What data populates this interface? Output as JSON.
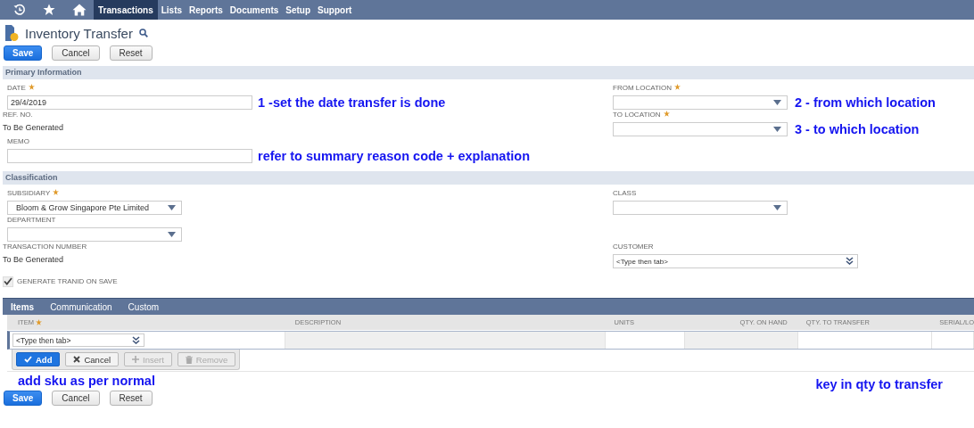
{
  "nav": {
    "menu": [
      {
        "label": "Transactions",
        "selected": true
      },
      {
        "label": "Lists",
        "selected": false
      },
      {
        "label": "Reports",
        "selected": false
      },
      {
        "label": "Documents",
        "selected": false
      },
      {
        "label": "Setup",
        "selected": false
      },
      {
        "label": "Support",
        "selected": false
      }
    ]
  },
  "page": {
    "title": "Inventory Transfer"
  },
  "top_buttons": [
    {
      "label": "Save",
      "kind": "primary"
    },
    {
      "label": "Cancel",
      "kind": "secondary"
    },
    {
      "label": "Reset",
      "kind": "secondary"
    }
  ],
  "sections": [
    {
      "title": "Primary Information",
      "rows": [
        {
          "left": {
            "kind": "text",
            "label": "DATE",
            "required": true,
            "value": "29/4/2019",
            "annotation": "1 -set the date transfer is done"
          },
          "right": {
            "kind": "select",
            "label": "FROM LOCATION",
            "required": true,
            "annotation": "2 - from which location"
          }
        },
        {
          "left": {
            "kind": "static",
            "label": "REF. NO.",
            "value": "To Be Generated"
          },
          "right": {
            "kind": "select",
            "label": "TO LOCATION",
            "required": true,
            "annotation": "3 - to which location"
          }
        },
        {
          "left": {
            "kind": "text",
            "label": "MEMO",
            "annotation": "refer to summary reason code + explanation"
          }
        }
      ]
    },
    {
      "title": "Classification",
      "rows": [
        {
          "left": {
            "kind": "select",
            "label": "SUBSIDIARY",
            "required": true,
            "value": "Bloom & Grow Singapore Pte Limited"
          },
          "right": {
            "kind": "select",
            "label": "CLASS"
          }
        },
        {
          "left": {
            "kind": "select",
            "label": "DEPARTMENT"
          }
        },
        {
          "left": {
            "kind": "static",
            "label": "TRANSACTION NUMBER",
            "value": "To Be Generated"
          },
          "right": {
            "kind": "autocomplete",
            "label": "CUSTOMER",
            "placeholder": "<Type then tab>"
          }
        },
        {
          "left": {
            "kind": "checkbox",
            "label": "GENERATE TRANID ON SAVE",
            "checked": true
          }
        }
      ]
    }
  ],
  "subtabs": [
    {
      "label": "Items",
      "selected": true
    },
    {
      "label": "Communication",
      "selected": false
    },
    {
      "label": "Custom",
      "selected": false
    }
  ],
  "items_table": {
    "columns": [
      {
        "label": "ITEM",
        "required": true,
        "kind": "text"
      },
      {
        "label": "DESCRIPTION",
        "kind": "text"
      },
      {
        "label": "UNITS",
        "kind": "text"
      },
      {
        "label": "QTY. ON HAND",
        "kind": "number"
      },
      {
        "label": "QTY. TO TRANSFER",
        "kind": "text"
      },
      {
        "label": "SERIAL/LO",
        "kind": "text"
      }
    ],
    "entry_row": [
      {
        "kind": "autocomplete",
        "placeholder": "<Type then tab>"
      },
      {
        "kind": "readonly"
      },
      {
        "kind": "input"
      },
      {
        "kind": "readonly"
      },
      {
        "kind": "input"
      },
      {
        "kind": "input"
      }
    ],
    "actions": [
      {
        "label": "Add",
        "kind": "add",
        "disabled": false
      },
      {
        "label": "Cancel",
        "kind": "cancel",
        "disabled": false
      },
      {
        "label": "Insert",
        "kind": "insert",
        "disabled": true
      },
      {
        "label": "Remove",
        "kind": "remove",
        "disabled": true
      }
    ]
  },
  "annotations": [
    {
      "text": "add sku as per normal"
    },
    {
      "text": "key in qty to transfer"
    }
  ],
  "bottom_buttons": [
    {
      "label": "Save",
      "kind": "primary"
    },
    {
      "label": "Cancel",
      "kind": "secondary"
    },
    {
      "label": "Reset",
      "kind": "secondary"
    }
  ]
}
